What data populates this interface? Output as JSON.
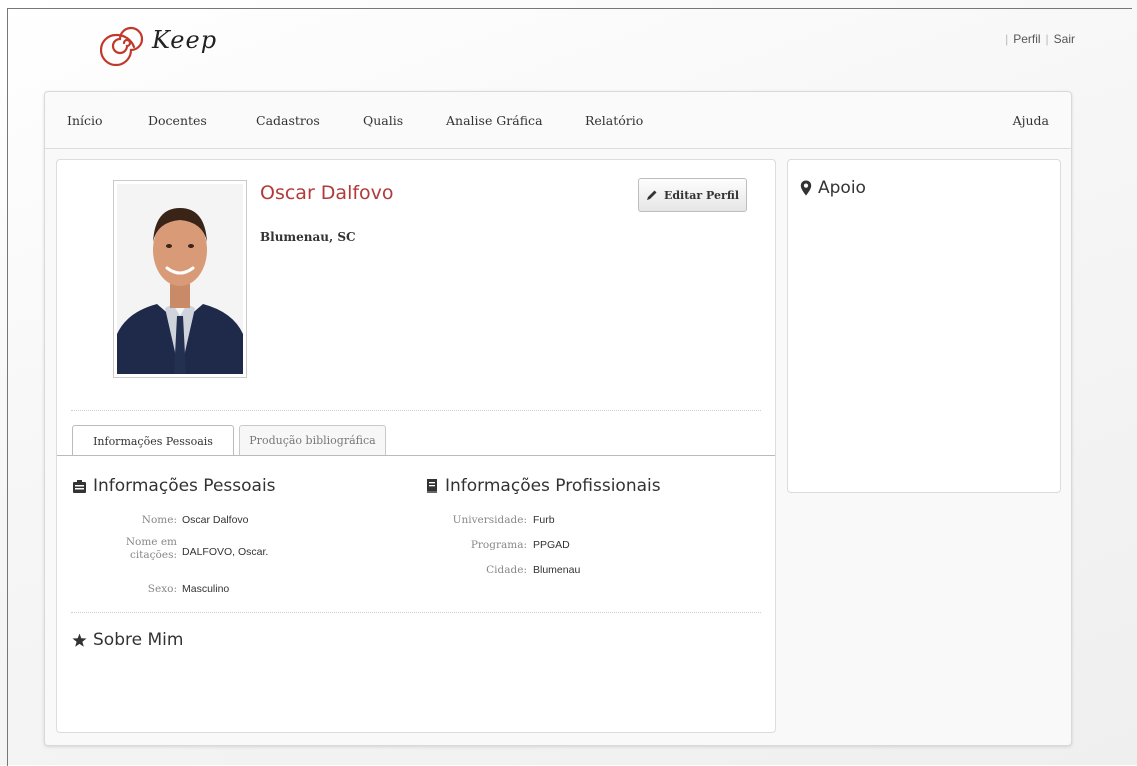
{
  "app": {
    "logo_text": "Keep"
  },
  "top_links": {
    "profile": "Perfil",
    "logout": "Sair"
  },
  "nav": {
    "items": [
      "Início",
      "Docentes",
      "Cadastros",
      "Qualis",
      "Analise Gráfica",
      "Relatório"
    ],
    "help": "Ajuda"
  },
  "profile": {
    "name": "Oscar Dalfovo",
    "location": "Blumenau, SC",
    "edit_button": "Editar Perfil"
  },
  "tabs": [
    "Informações Pessoais",
    "Produção bibliográfica"
  ],
  "personal": {
    "title": "Informações Pessoais",
    "fields": [
      {
        "label": "Nome:",
        "value": "Oscar Dalfovo"
      },
      {
        "label_line1": "Nome em",
        "label_line2": "citações:",
        "value": "DALFOVO, Oscar."
      },
      {
        "label": "Sexo:",
        "value": "Masculino"
      }
    ]
  },
  "professional": {
    "title": "Informações Profissionais",
    "fields": [
      {
        "label": "Universidade:",
        "value": "Furb"
      },
      {
        "label": "Programa:",
        "value": "PPGAD"
      },
      {
        "label": "Cidade:",
        "value": "Blumenau"
      }
    ]
  },
  "about": {
    "title": "Sobre Mim"
  },
  "side": {
    "title": "Apoio"
  },
  "colors": {
    "name_red": "#b33a3a",
    "logo_red": "#c0392b"
  },
  "icons": [
    "spiral-logo-icon",
    "pencil-icon",
    "id-card-icon",
    "book-icon",
    "star-icon",
    "map-marker-icon"
  ]
}
